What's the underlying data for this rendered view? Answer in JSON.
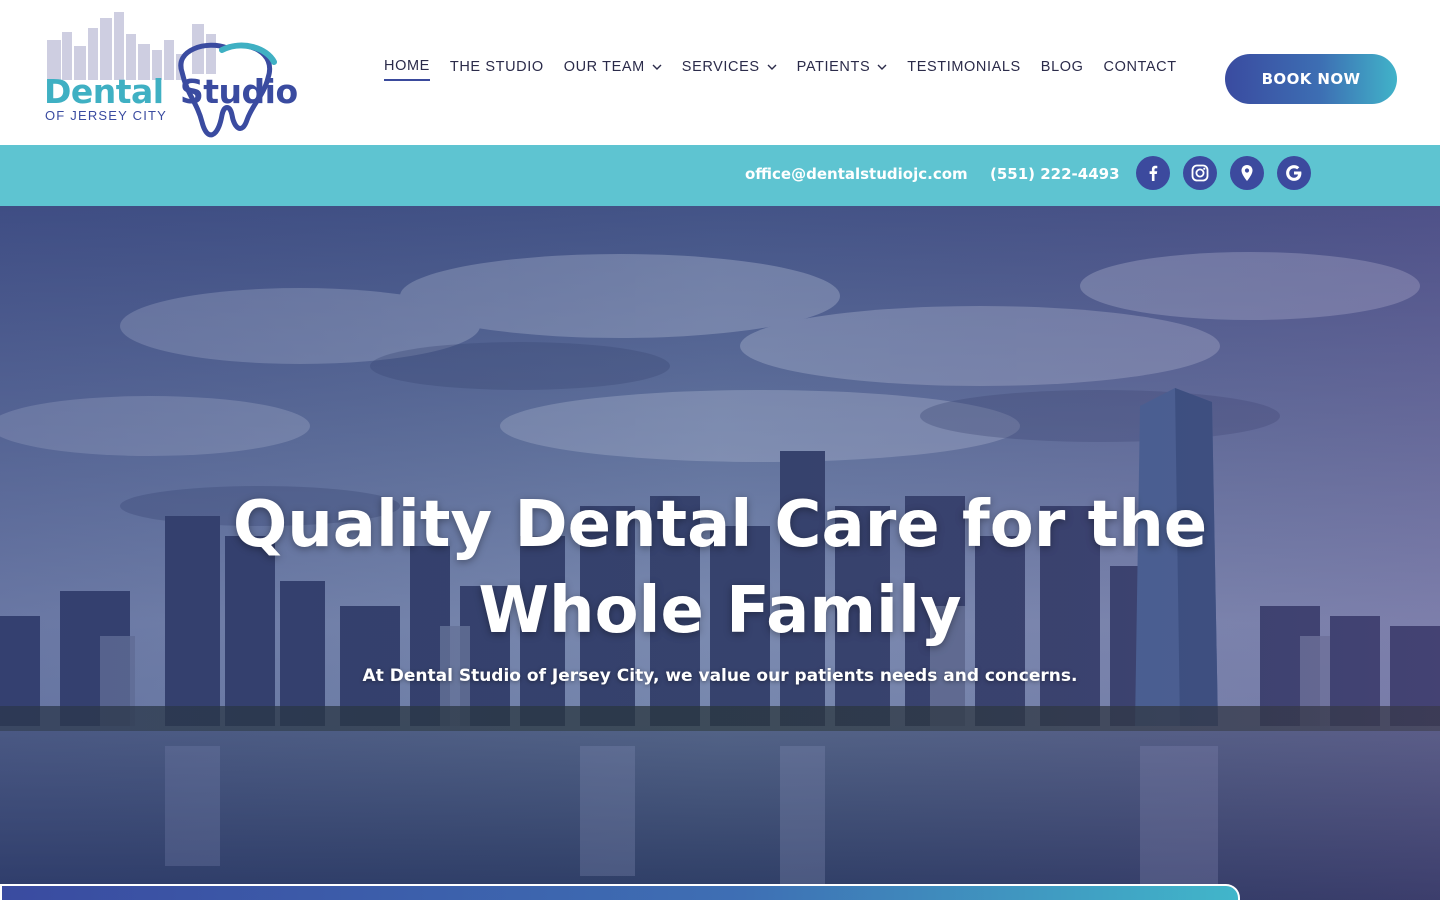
{
  "brand": {
    "name_part1": "Dental",
    "name_part2": "Studio",
    "tagline": "OF JERSEY CITY",
    "colors": {
      "teal": "#3fb0c3",
      "navy": "#3a4ba0"
    }
  },
  "nav": {
    "items": [
      {
        "label": "HOME",
        "active": true,
        "dropdown": false
      },
      {
        "label": "THE STUDIO",
        "active": false,
        "dropdown": false
      },
      {
        "label": "OUR TEAM",
        "active": false,
        "dropdown": true
      },
      {
        "label": "SERVICES",
        "active": false,
        "dropdown": true
      },
      {
        "label": "PATIENTS",
        "active": false,
        "dropdown": true
      },
      {
        "label": "TESTIMONIALS",
        "active": false,
        "dropdown": false
      },
      {
        "label": "BLOG",
        "active": false,
        "dropdown": false
      },
      {
        "label": "CONTACT",
        "active": false,
        "dropdown": false
      }
    ],
    "book_label": "BOOK NOW"
  },
  "contact_bar": {
    "email": "office@dentalstudiojc.com",
    "phone": "(551) 222-4493",
    "social": [
      "facebook-icon",
      "instagram-icon",
      "map-pin-icon",
      "google-icon"
    ],
    "bg_color": "#5ec4d1"
  },
  "hero": {
    "title_line1": "Quality Dental Care for the",
    "title_line2": "Whole Family",
    "subtitle": "At Dental Studio of Jersey City, we value our patients needs and concerns."
  }
}
